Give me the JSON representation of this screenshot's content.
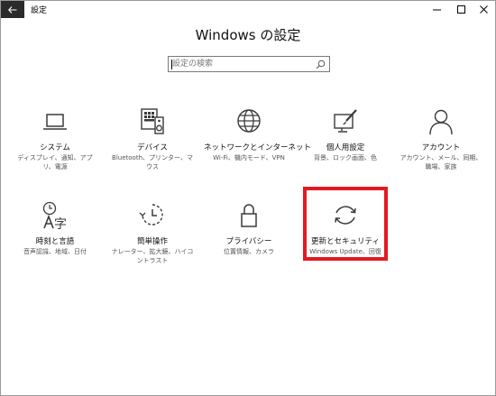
{
  "window": {
    "title": "設定"
  },
  "header": {
    "page_title": "Windows の設定"
  },
  "search": {
    "placeholder": "設定の検索",
    "value": ""
  },
  "tiles": [
    {
      "name": "システム",
      "desc": "ディスプレイ、通知、アプリ、電源",
      "icon": "laptop-icon"
    },
    {
      "name": "デバイス",
      "desc": "Bluetooth、プリンター、マウス",
      "icon": "keyboard-speaker-icon"
    },
    {
      "name": "ネットワークとインターネット",
      "desc": "Wi-Fi、機内モード、VPN",
      "icon": "globe-icon"
    },
    {
      "name": "個人用設定",
      "desc": "背景、ロック画面、色",
      "icon": "paint-screen-icon"
    },
    {
      "name": "アカウント",
      "desc": "アカウント、メール、同期、職場、家族",
      "icon": "person-icon"
    },
    {
      "name": "時刻と言語",
      "desc": "音声認識、地域、日付",
      "icon": "time-language-icon"
    },
    {
      "name": "簡単操作",
      "desc": "ナレーター、拡大鏡、ハイコントラスト",
      "icon": "ease-of-access-icon"
    },
    {
      "name": "プライバシー",
      "desc": "位置情報、カメラ",
      "icon": "lock-icon"
    },
    {
      "name": "更新とセキュリティ",
      "desc": "Windows Update、回復",
      "icon": "sync-arrows-icon"
    }
  ],
  "colors": {
    "highlight": "#e21a22",
    "back_button_bg": "#2b2b2b",
    "icon_stroke": "#3a3a3a"
  }
}
